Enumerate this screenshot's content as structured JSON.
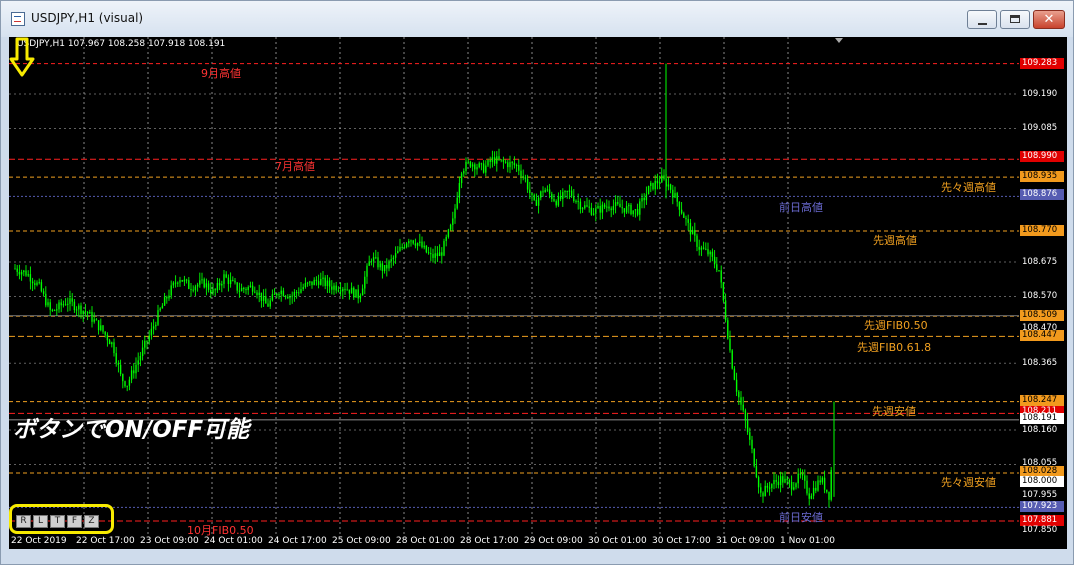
{
  "window": {
    "title": "USDJPY,H1 (visual)",
    "minimize": "minimize",
    "maximize": "maximize",
    "close": "✕"
  },
  "chart": {
    "info": "USDJPY,H1  107.967 108.258 107.918 108.191",
    "labels": {
      "month_high": "9月高値",
      "july_high": "7月高値",
      "prev_day_high": "前日高値",
      "two_weeks_ago_high": "先々週高値",
      "last_week_high": "先週高値",
      "last_week_fib50": "先週FIB0.50",
      "last_week_fib618": "先週FIB0.61.8",
      "last_week_low": "先週安値",
      "two_weeks_ago_low": "先々週安値",
      "prev_day_low": "前日安値",
      "oct_fib50": "10月FIB0.50"
    },
    "overlay_text": "ボタンでON/OFF可能",
    "buttons": [
      "R",
      "L",
      "T",
      "F",
      "Z"
    ],
    "time_labels": [
      "22 Oct 2019",
      "22 Oct 17:00",
      "23 Oct 09:00",
      "24 Oct 01:00",
      "24 Oct 17:00",
      "25 Oct 09:00",
      "28 Oct 01:00",
      "28 Oct 17:00",
      "29 Oct 09:00",
      "30 Oct 01:00",
      "30 Oct 17:00",
      "31 Oct 09:00",
      "1 Nov 01:00"
    ],
    "price_levels": {
      "p109283": "109.283",
      "p109190": "109.190",
      "p109085": "109.085",
      "p108990": "108.990",
      "p108935": "108.935",
      "p108876": "108.876",
      "p108770": "108.770",
      "p108675": "108.675",
      "p108570": "108.570",
      "p108509": "108.509",
      "p108470": "108.470",
      "p108447": "108.447",
      "p108365": "108.365",
      "p108247": "108.247",
      "p108211": "108.211",
      "p108191": "108.191",
      "p108160": "108.160",
      "p108055": "108.055",
      "p108028": "108.028",
      "p108000": "108.000",
      "p107955": "107.955",
      "p107923": "107.923",
      "p107881": "107.881",
      "p107850": "107.850"
    },
    "colors": {
      "background": "#000000",
      "candles": "#00ff00",
      "red_line": "#ff2020",
      "orange_line": "#f0a020",
      "blue_line": "#565cb2",
      "grid": "#c0c0c0",
      "highlight": "#f7ea00"
    }
  }
}
